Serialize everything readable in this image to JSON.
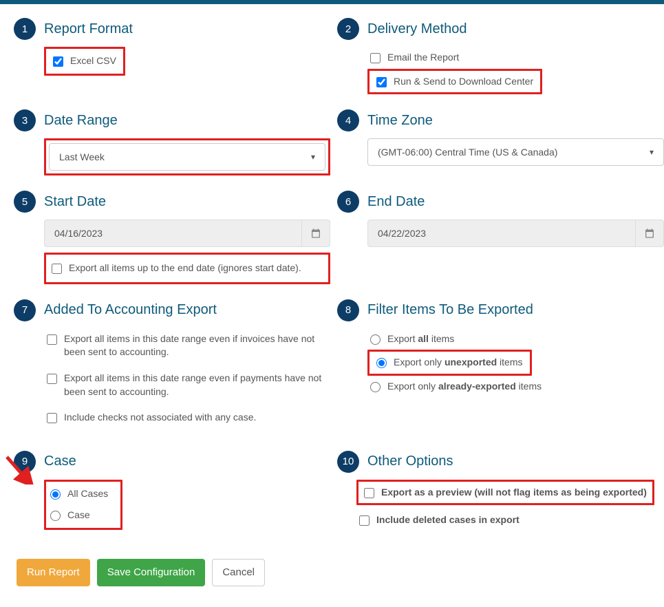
{
  "sections": {
    "s1": {
      "title": "Report Format"
    },
    "s2": {
      "title": "Delivery Method"
    },
    "s3": {
      "title": "Date Range"
    },
    "s4": {
      "title": "Time Zone"
    },
    "s5": {
      "title": "Start Date"
    },
    "s6": {
      "title": "End Date"
    },
    "s7": {
      "title": "Added To Accounting Export"
    },
    "s8": {
      "title": "Filter Items To Be Exported"
    },
    "s9": {
      "title": "Case"
    },
    "s10": {
      "title": "Other Options"
    }
  },
  "reportFormat": {
    "excelCsv": "Excel CSV"
  },
  "delivery": {
    "email": "Email the Report",
    "runSend": "Run & Send to Download Center"
  },
  "dateRange": {
    "selected": "Last Week"
  },
  "timeZone": {
    "selected": "(GMT-06:00) Central Time (US & Canada)"
  },
  "startDate": {
    "value": "04/16/2023",
    "exportAll": "Export all items up to the end date (ignores start date)."
  },
  "endDate": {
    "value": "04/22/2023"
  },
  "accounting": {
    "opt1": "Export all items in this date range even if invoices have not been sent to accounting.",
    "opt2": "Export all items in this date range even if payments have not been sent to accounting.",
    "opt3": "Include checks not associated with any case."
  },
  "filter": {
    "opt1_pre": "Export ",
    "opt1_b": "all",
    "opt1_post": " items",
    "opt2_pre": "Export only ",
    "opt2_b": "unexported",
    "opt2_post": " items",
    "opt3_pre": "Export only ",
    "opt3_b": "already-exported",
    "opt3_post": " items"
  },
  "caseSec": {
    "all": "All Cases",
    "case": "Case"
  },
  "other": {
    "preview": "Export as a preview (will not flag items as being exported)",
    "deleted": "Include deleted cases in export"
  },
  "buttons": {
    "run": "Run Report",
    "save": "Save Configuration",
    "cancel": "Cancel"
  }
}
